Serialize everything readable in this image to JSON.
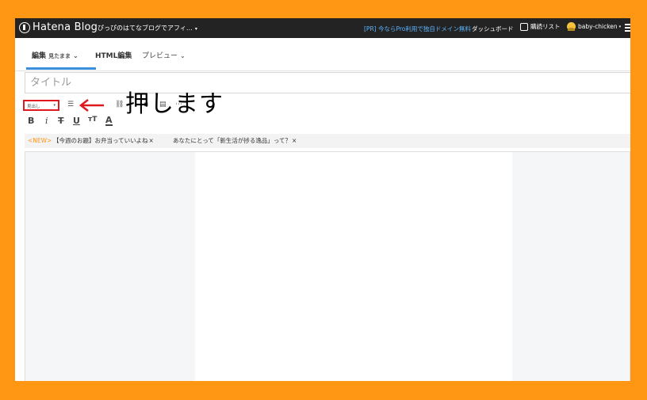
{
  "topbar": {
    "logo_text": "Hatena Blog",
    "blog_name": "ぴっぴのはてなブログでアフィ…",
    "pr_link": "[PR] 今ならPro利用で独自ドメイン無料",
    "dashboard": "ダッシュボード",
    "reading_list": "購読リスト",
    "username": "baby-chicken"
  },
  "tabs": {
    "edit_label": "編集",
    "edit_sub": "見たまま",
    "html_label": "HTML編集",
    "preview_label": "プレビュー"
  },
  "editor": {
    "title_placeholder": "タイトル",
    "heading_select_value": "見出し"
  },
  "annotation": {
    "text": "押します",
    "color": "#e0191f"
  },
  "format_buttons": {
    "bold": "B",
    "italic": "i",
    "strike": "T",
    "underline": "U",
    "size": "тT",
    "color": "A"
  },
  "topics": {
    "new_label": "<NEW>",
    "topic1": "【今週のお題】お弁当っていいよね",
    "topic2": "あなたにとって「新生活が捗る逸品」って？",
    "close": "×"
  },
  "colors": {
    "background": "#ff9614",
    "topbar": "#232323",
    "accent": "#3a8fdc",
    "pr_link": "#5cb4ff"
  }
}
